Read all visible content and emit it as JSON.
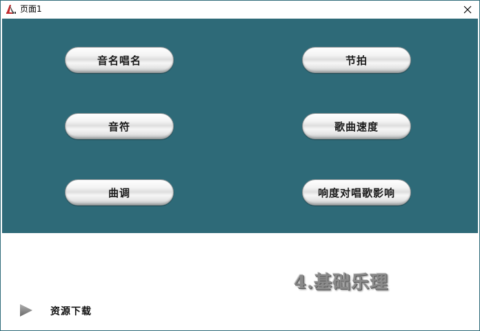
{
  "window": {
    "title": "页面1"
  },
  "buttons": {
    "solmization": "音名唱名",
    "meter": "节拍",
    "notes": "音符",
    "tempo": "歌曲速度",
    "key": "曲调",
    "dynamics": "响度对唱歌影响"
  },
  "footer": {
    "section_title": "4.基础乐理",
    "resource_link": "资源下载"
  },
  "colors": {
    "panel_bg": "#2e6a78",
    "button_text": "#1a1a1a"
  },
  "icons": {
    "app": "music-app-icon",
    "close": "close-icon",
    "play": "play-triangle-icon"
  }
}
